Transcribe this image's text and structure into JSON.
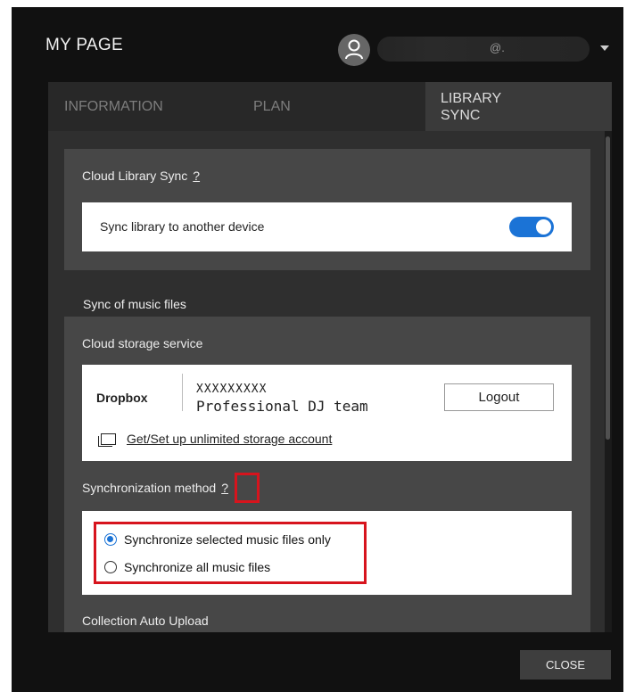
{
  "window": {
    "title": "MY PAGE"
  },
  "account": {
    "display_text": "@.",
    "avatar_icon": "user-icon",
    "dropdown_icon": "caret-down-icon"
  },
  "tabs": [
    {
      "label": "INFORMATION",
      "active": false
    },
    {
      "label": "PLAN",
      "active": false
    },
    {
      "label": "LIBRARY\nSYNC",
      "active": true
    }
  ],
  "cloud_library_sync": {
    "title": "Cloud Library Sync",
    "help": "?",
    "toggle_label": "Sync library to another device",
    "toggle_on": true
  },
  "music_sync": {
    "title": "Sync of music files",
    "cloud_storage": {
      "title": "Cloud storage service",
      "provider": "Dropbox",
      "account_id": "XXXXXXXXX",
      "account_name": "Professional DJ team",
      "logout_label": "Logout",
      "link_icon": "external-window-icon",
      "link_label": "Get/Set up unlimited storage account"
    },
    "method": {
      "title": "Synchronization method",
      "help": "?",
      "options": [
        {
          "label": "Synchronize selected music files only",
          "selected": true
        },
        {
          "label": "Synchronize all music files",
          "selected": false
        }
      ]
    },
    "auto_upload_title": "Collection Auto Upload"
  },
  "footer": {
    "close_label": "CLOSE"
  },
  "colors": {
    "accent": "#1b73d6",
    "highlight": "#d7141d",
    "background": "#111111"
  }
}
